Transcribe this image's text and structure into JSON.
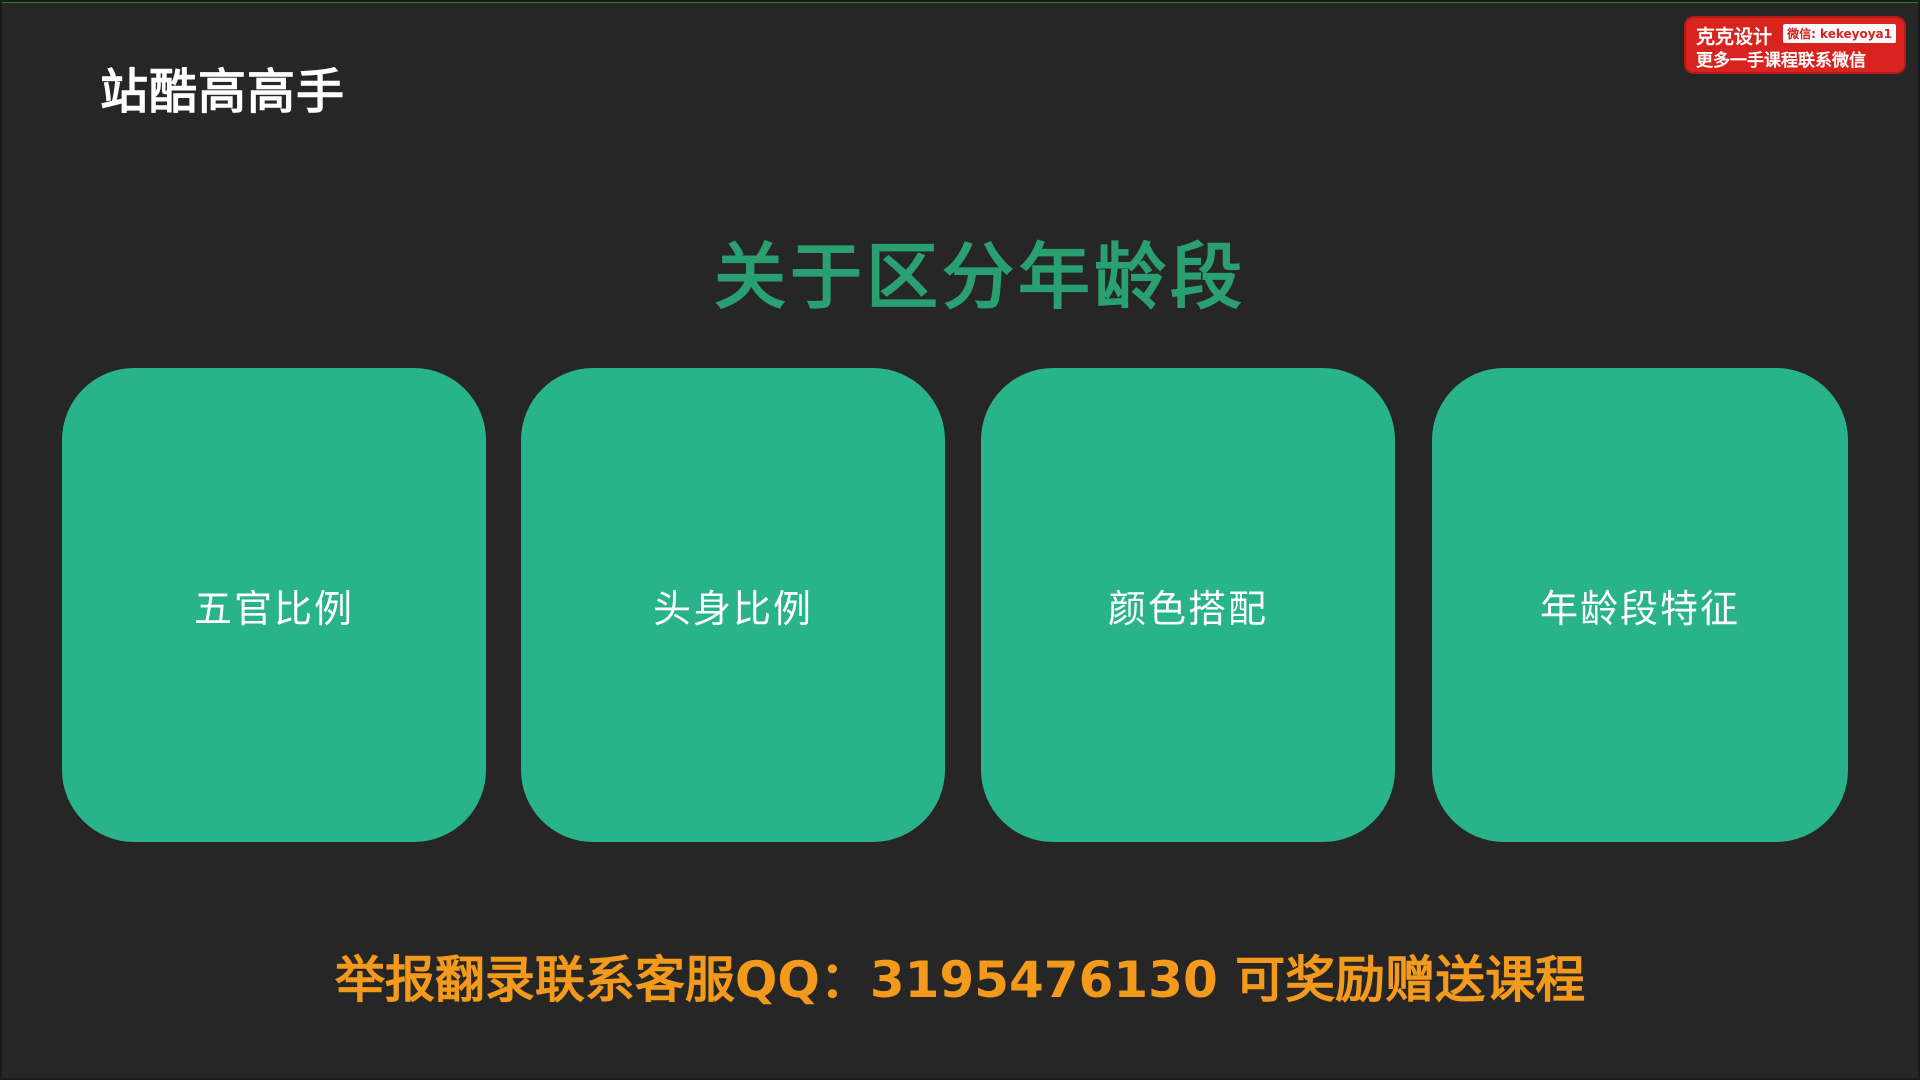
{
  "logo": {
    "text": "站酷高高手"
  },
  "badge": {
    "line1": "克克设计",
    "wechat": "微信: kekeyoya1",
    "line2": "更多一手课程联系微信",
    "color": "#d8231e"
  },
  "title": "关于区分年龄段",
  "cards": [
    {
      "label": "五官比例"
    },
    {
      "label": "头身比例"
    },
    {
      "label": "颜色搭配"
    },
    {
      "label": "年龄段特征"
    }
  ],
  "footer": "举报翻录联系客服QQ：3195476130  可奖励赠送课程",
  "colors": {
    "background": "#262626",
    "card": "#29b38a",
    "title": "#2a9f72",
    "footer": "#f39a1c"
  }
}
